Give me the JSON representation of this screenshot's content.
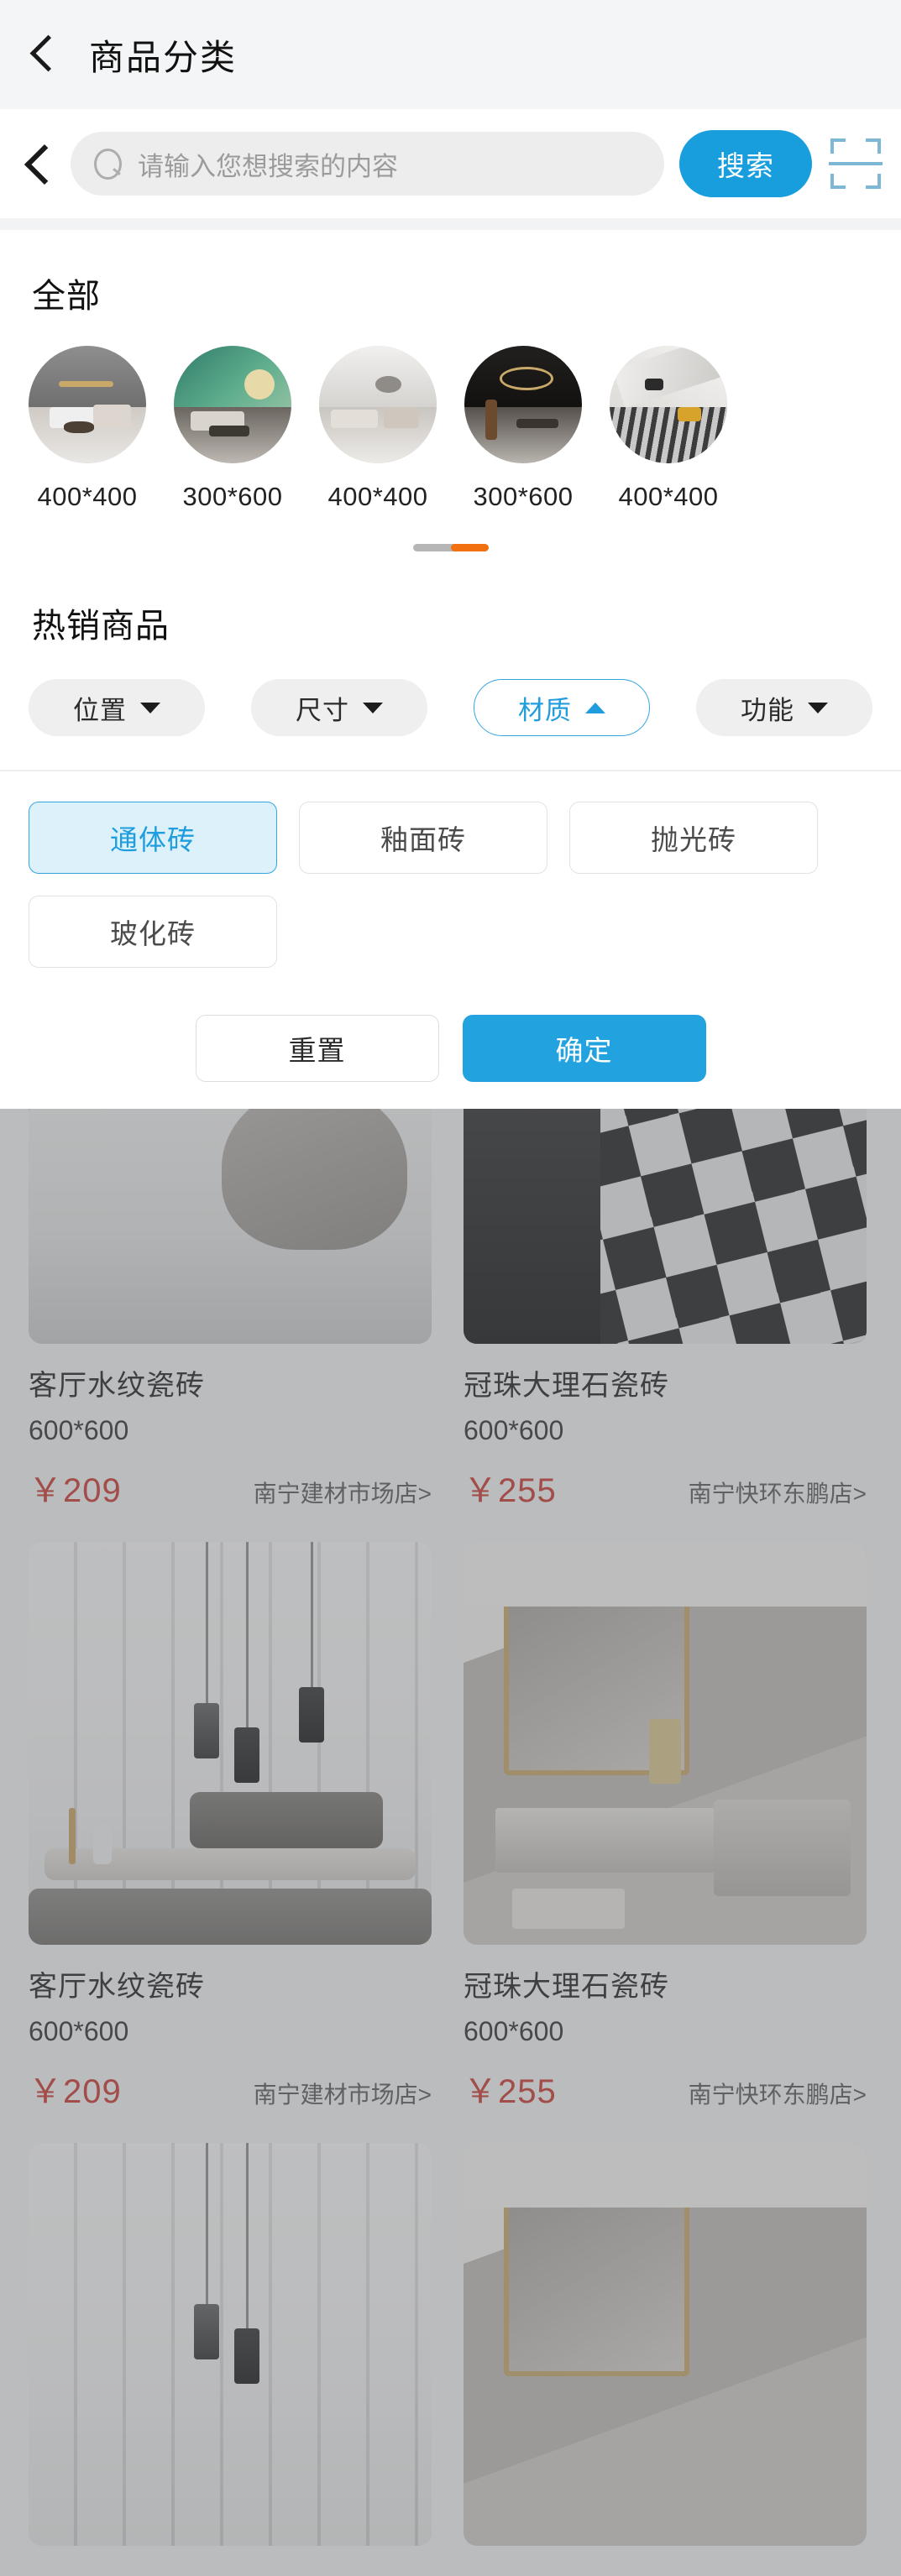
{
  "nav": {
    "back_icon": "chevron-left-icon",
    "title": "商品分类"
  },
  "search": {
    "back_icon": "chevron-left-icon",
    "icon": "search-icon",
    "placeholder": "请输入您想搜索的内容",
    "value": "",
    "button_label": "搜索",
    "scan_icon": "scan-icon"
  },
  "categories": {
    "title": "全部",
    "items": [
      {
        "label": "400*400"
      },
      {
        "label": "300*600"
      },
      {
        "label": "400*400"
      },
      {
        "label": "300*600"
      },
      {
        "label": "400*400"
      }
    ]
  },
  "hot": {
    "title": "热销商品",
    "filters": [
      {
        "label": "位置",
        "caret": "down",
        "active": false
      },
      {
        "label": "尺寸",
        "caret": "down",
        "active": false
      },
      {
        "label": "材质",
        "caret": "up",
        "active": true
      },
      {
        "label": "功能",
        "caret": "down",
        "active": false
      }
    ]
  },
  "material_panel": {
    "options": [
      {
        "label": "通体砖",
        "selected": true
      },
      {
        "label": "釉面砖",
        "selected": false
      },
      {
        "label": "抛光砖",
        "selected": false
      },
      {
        "label": "玻化砖",
        "selected": false
      }
    ],
    "reset_label": "重置",
    "confirm_label": "确定"
  },
  "products": [
    {
      "name": "客厅水纹瓷砖",
      "size": "600*600",
      "price": "￥209",
      "store": "南宁建材市场店>"
    },
    {
      "name": "冠珠大理石瓷砖",
      "size": "600*600",
      "price": "￥255",
      "store": "南宁快环东鹏店>"
    },
    {
      "name": "客厅水纹瓷砖",
      "size": "600*600",
      "price": "￥209",
      "store": "南宁建材市场店>"
    },
    {
      "name": "冠珠大理石瓷砖",
      "size": "600*600",
      "price": "￥255",
      "store": "南宁快环东鹏店>"
    }
  ],
  "colors": {
    "accent_blue": "#189ddd",
    "price_red": "#c8352c",
    "indicator_orange": "#f2700f",
    "chip_bg": "#efefef"
  }
}
